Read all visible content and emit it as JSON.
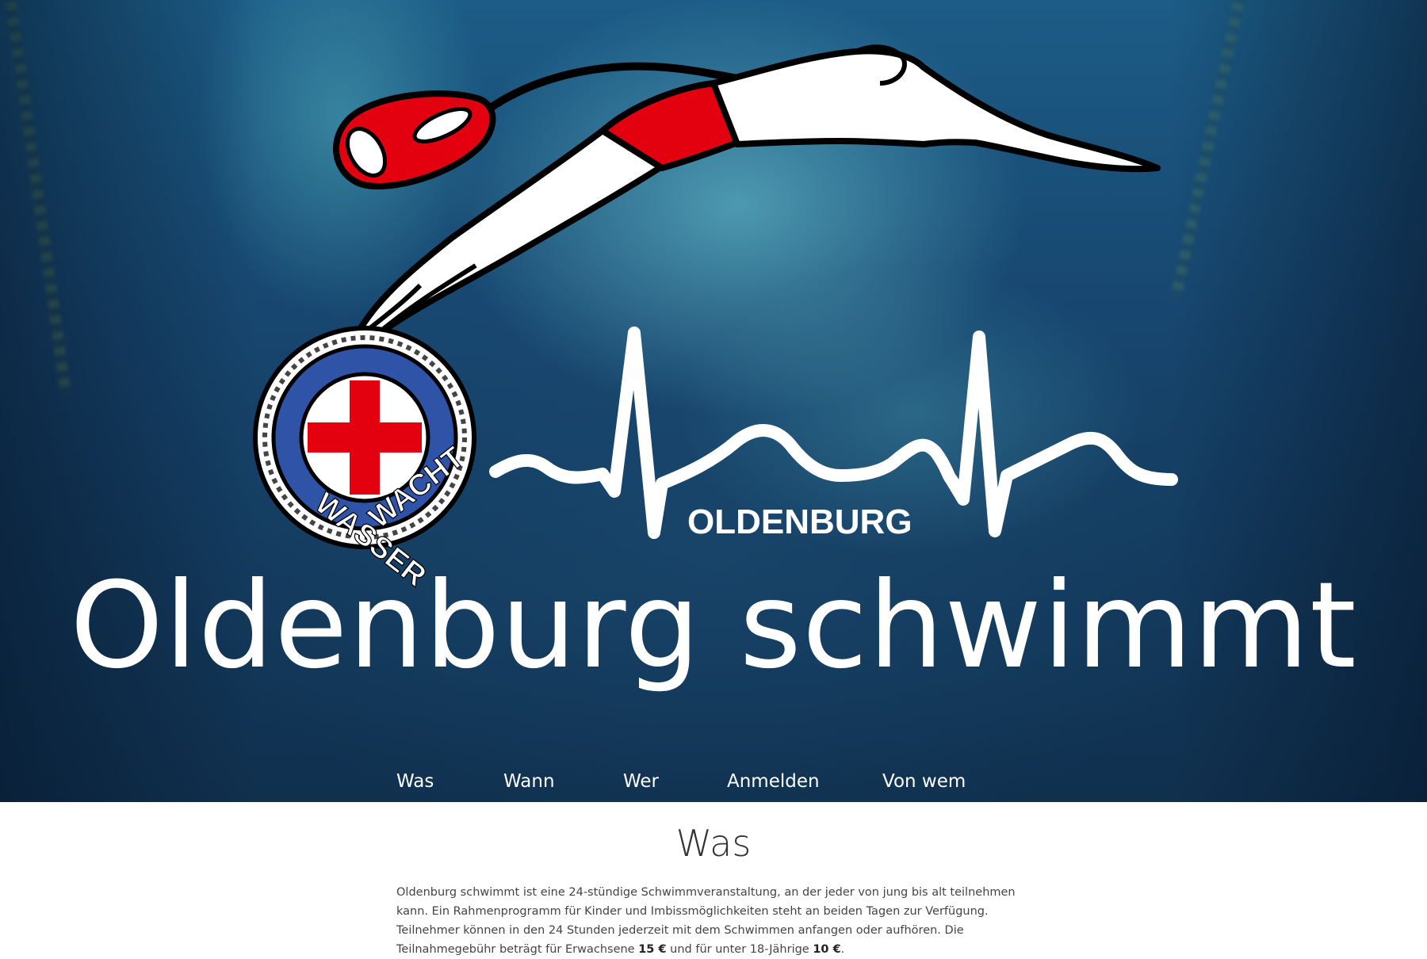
{
  "hero": {
    "logo_badge_text_left": "WASSER",
    "logo_badge_text_right": "WACHT",
    "logo_city": "OLDENBURG",
    "title": "Oldenburg schwimmt"
  },
  "nav": {
    "items": [
      {
        "label": "Was"
      },
      {
        "label": "Wann"
      },
      {
        "label": "Wer"
      },
      {
        "label": "Anmelden"
      },
      {
        "label": "Von wem"
      }
    ]
  },
  "section": {
    "heading": "Was",
    "text_1": "Oldenburg schwimmt ist eine 24-stündige Schwimmveranstaltung, an der jeder von jung bis alt teilnehmen kann. Ein Rahmenprogramm für Kinder und Imbissmöglichkeiten steht an beiden Tagen zur Verfügung. Teilnehmer können in den 24 Stunden jederzeit mit dem Schwimmen anfangen oder aufhören. Die Teilnahmegebühr beträgt für Erwachsene ",
    "price_adult": "15 €",
    "text_2": " und für unter 18-Jährige ",
    "price_youth": "10 €",
    "text_3": "."
  },
  "colors": {
    "hero_dark": "#133a5d",
    "hero_light": "#7fd6e0",
    "red": "#e3000f",
    "badge_blue": "#2f53a6",
    "white": "#ffffff"
  }
}
